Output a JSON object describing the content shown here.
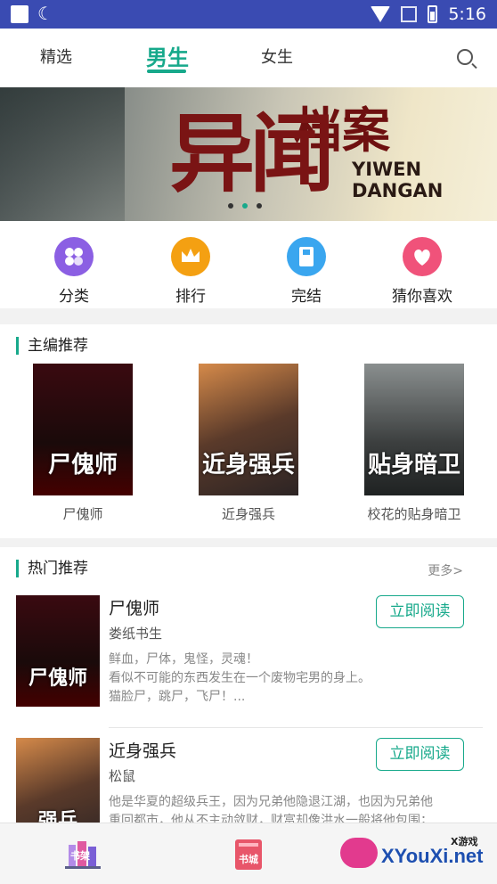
{
  "status_bar": {
    "time": "5:16"
  },
  "tabs": [
    {
      "label": "精选"
    },
    {
      "label": "男生"
    },
    {
      "label": "女生"
    }
  ],
  "banner": {
    "title_main": "异闻",
    "title_side": "档案",
    "title_en_1": "YIWEN",
    "title_en_2": "DANGAN"
  },
  "quick_links": [
    {
      "label": "分类",
      "color": "#8b5fe3"
    },
    {
      "label": "排行",
      "color": "#f4a012"
    },
    {
      "label": "完结",
      "color": "#3aa6ef"
    },
    {
      "label": "猜你喜欢",
      "color": "#f0527a"
    }
  ],
  "editor_picks": {
    "title": "主编推荐",
    "books": [
      {
        "name": "尸傀师",
        "cover_text": "尸傀师"
      },
      {
        "name": "近身强兵",
        "cover_text": "近身强兵"
      },
      {
        "name": "校花的贴身暗卫",
        "cover_text": "贴身暗卫"
      }
    ]
  },
  "hot": {
    "title": "热门推荐",
    "more": "更多>",
    "books": [
      {
        "title": "尸傀师",
        "author": "娄纸书生",
        "desc_1": "鲜血，尸体，鬼怪，灵魂！",
        "desc_2": "看似不可能的东西发生在一个废物宅男的身上。",
        "desc_3": "猫脸尸，跳尸，飞尸！...",
        "button": "立即阅读",
        "cover_text": "尸傀师"
      },
      {
        "title": "近身强兵",
        "author": "松鼠",
        "desc_1": "他是华夏的超级兵王，因为兄弟他隐退江湖，也因为兄弟他",
        "desc_2": "重回都市，他从不主动敛财，财富却像洪水一般将他包围；",
        "desc_3": "",
        "button": "立即阅读",
        "cover_text": "强兵"
      }
    ]
  },
  "bottom_nav": [
    {
      "label": "书架"
    },
    {
      "label": "书城"
    }
  ],
  "watermark": {
    "text": "XYouXi.net",
    "small": "X游戏"
  }
}
